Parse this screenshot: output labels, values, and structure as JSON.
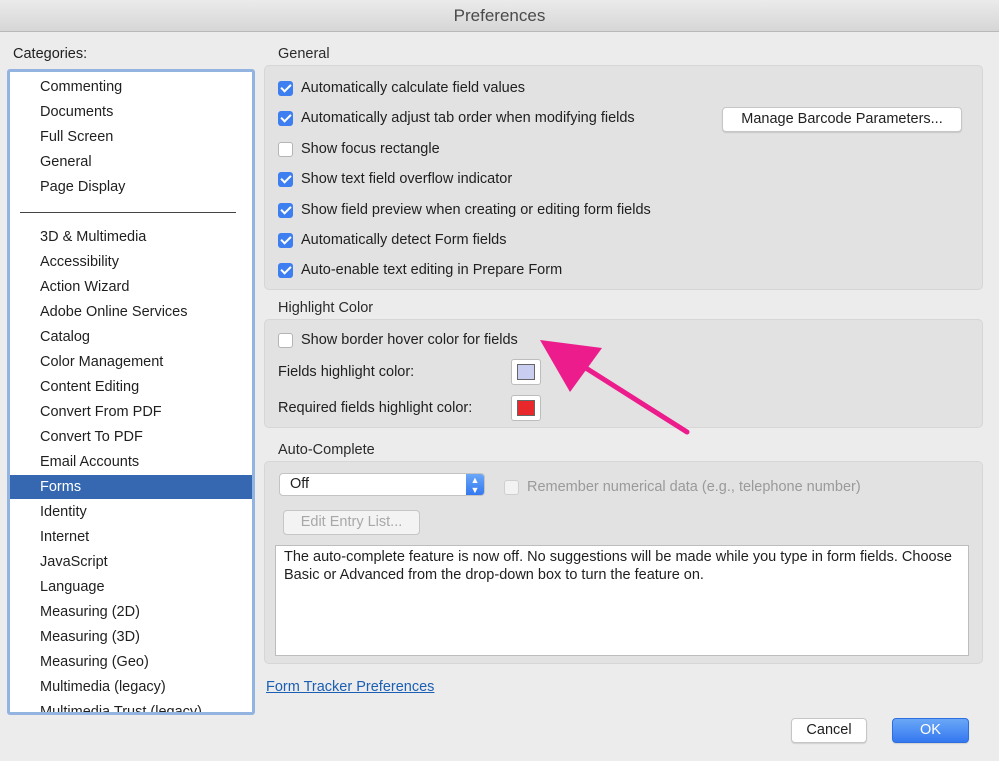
{
  "window": {
    "title": "Preferences"
  },
  "categories": {
    "label": "Categories:",
    "top_items": [
      "Commenting",
      "Documents",
      "Full Screen",
      "General",
      "Page Display"
    ],
    "items": [
      "3D & Multimedia",
      "Accessibility",
      "Action Wizard",
      "Adobe Online Services",
      "Catalog",
      "Color Management",
      "Content Editing",
      "Convert From PDF",
      "Convert To PDF",
      "Email Accounts",
      "Forms",
      "Identity",
      "Internet",
      "JavaScript",
      "Language",
      "Measuring (2D)",
      "Measuring (3D)",
      "Measuring (Geo)",
      "Multimedia (legacy)",
      "Multimedia Trust (legacy)"
    ],
    "selected": "Forms"
  },
  "general": {
    "title": "General",
    "options": [
      {
        "label": "Automatically calculate field values",
        "checked": true
      },
      {
        "label": "Automatically adjust tab order when modifying fields",
        "checked": true
      },
      {
        "label": "Show focus rectangle",
        "checked": false
      },
      {
        "label": "Show text field overflow indicator",
        "checked": true
      },
      {
        "label": "Show field preview when creating or editing form fields",
        "checked": true
      },
      {
        "label": "Automatically detect Form fields",
        "checked": true
      },
      {
        "label": "Auto-enable text editing in Prepare Form",
        "checked": true
      }
    ],
    "barcode_button": "Manage Barcode Parameters..."
  },
  "highlight": {
    "title": "Highlight Color",
    "hover_label": "Show border hover color for fields",
    "hover_checked": false,
    "fields_label": "Fields highlight color:",
    "fields_color": "#c9cdf0",
    "required_label": "Required fields highlight color:",
    "required_color": "#e8282a"
  },
  "autocomplete": {
    "title": "Auto-Complete",
    "selected": "Off",
    "remember_label": "Remember numerical data (e.g., telephone number)",
    "edit_button": "Edit Entry List...",
    "description": "The auto-complete feature is now off. No suggestions will be made while you type in form fields. Choose Basic or Advanced from the drop-down box to turn the feature on."
  },
  "footer": {
    "link": "Form Tracker Preferences",
    "cancel": "Cancel",
    "ok": "OK"
  },
  "annotation": {
    "arrow_color": "#ec1c8c",
    "arrow_icon": "pink-arrow-icon"
  }
}
